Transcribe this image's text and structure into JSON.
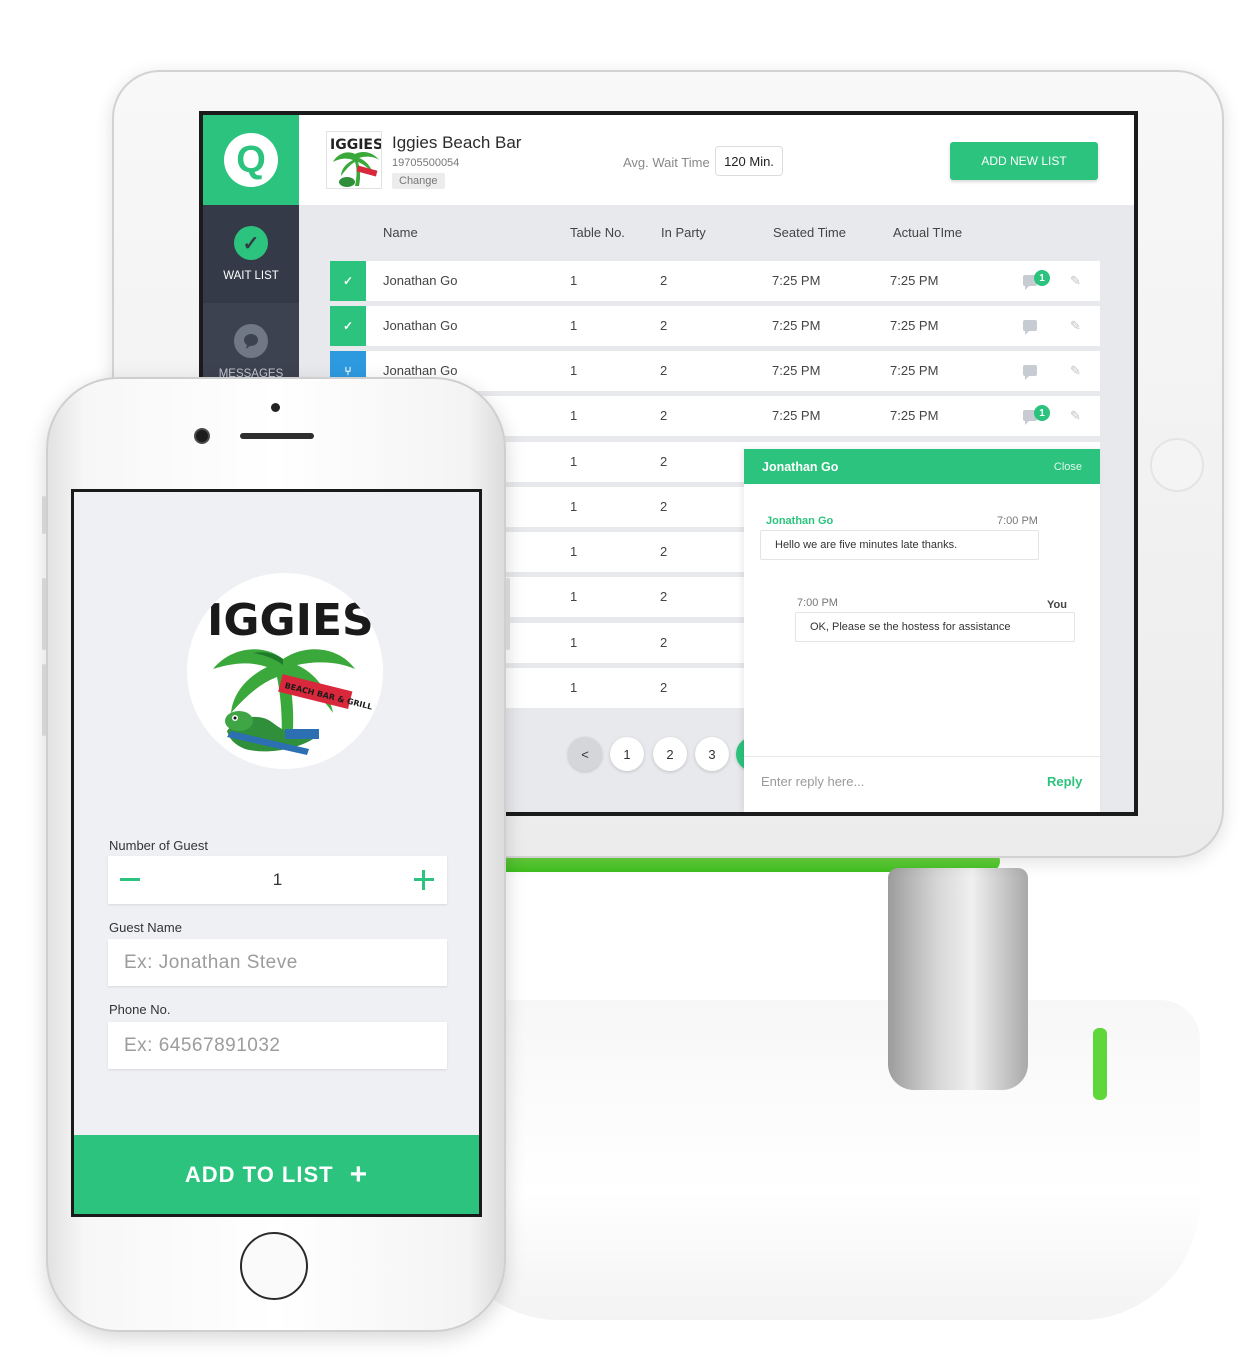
{
  "colors": {
    "accent": "#2bc37d",
    "sidebar": "#3c4250",
    "seated_blue": "#2d9ae0",
    "stand_green": "#5fd63a"
  },
  "tablet": {
    "sidebar": {
      "logo_letter": "Q",
      "items": [
        {
          "label": "WAIT LIST",
          "icon": "check-icon",
          "active": true
        },
        {
          "label": "MESSAGES",
          "icon": "chat-bubble-icon",
          "active": false
        }
      ]
    },
    "header": {
      "restaurant_name": "Iggies Beach Bar",
      "restaurant_phone": "19705500054",
      "change_label": "Change",
      "avg_wait_label": "Avg. Wait Time",
      "avg_wait_value": "120 Min.",
      "add_new_list_label": "ADD NEW LIST"
    },
    "table": {
      "columns": [
        "Name",
        "Table No.",
        "In Party",
        "Seated Time",
        "Actual TIme"
      ],
      "rows": [
        {
          "status": "check",
          "name": "Jonathan Go",
          "table_no": "1",
          "party": "2",
          "seated": "7:25 PM",
          "actual": "7:25 PM",
          "badge": "1"
        },
        {
          "status": "check",
          "name": "Jonathan Go",
          "table_no": "1",
          "party": "2",
          "seated": "7:25 PM",
          "actual": "7:25 PM",
          "badge": ""
        },
        {
          "status": "seated",
          "name": "Jonathan Go",
          "table_no": "1",
          "party": "2",
          "seated": "7:25 PM",
          "actual": "7:25 PM",
          "badge": ""
        },
        {
          "status": "",
          "name": "",
          "table_no": "1",
          "party": "2",
          "seated": "7:25 PM",
          "actual": "7:25 PM",
          "badge": "1"
        },
        {
          "status": "",
          "name": "",
          "table_no": "1",
          "party": "2",
          "seated": "",
          "actual": "",
          "badge": ""
        },
        {
          "status": "",
          "name": "",
          "table_no": "1",
          "party": "2",
          "seated": "",
          "actual": "",
          "badge": ""
        },
        {
          "status": "",
          "name": "",
          "table_no": "1",
          "party": "2",
          "seated": "",
          "actual": "",
          "badge": ""
        },
        {
          "status": "",
          "name": "",
          "table_no": "1",
          "party": "2",
          "seated": "",
          "actual": "",
          "badge": ""
        },
        {
          "status": "",
          "name": "",
          "table_no": "1",
          "party": "2",
          "seated": "",
          "actual": "",
          "badge": ""
        },
        {
          "status": "",
          "name": "",
          "table_no": "1",
          "party": "2",
          "seated": "",
          "actual": "",
          "badge": ""
        }
      ]
    },
    "pagination": {
      "prev": "<",
      "pages": [
        "1",
        "2",
        "3"
      ]
    },
    "chat": {
      "title": "Jonathan Go",
      "close_label": "Close",
      "messages": [
        {
          "sender": "Jonathan Go",
          "time": "7:00 PM",
          "text": "Hello we are five minutes late thanks."
        },
        {
          "sender": "You",
          "time": "7:00 PM",
          "text": "OK, Please se the hostess for assistance"
        }
      ],
      "reply_placeholder": "Enter reply here...",
      "reply_label": "Reply"
    }
  },
  "phone": {
    "logo_text": "IGGIES",
    "logo_subtext": "BEACH BAR & GRILL",
    "guest_count_label": "Number of Guest",
    "guest_count": "1",
    "guest_name_label": "Guest Name",
    "guest_name_placeholder": "Ex: Jonathan Steve",
    "phone_label": "Phone No.",
    "phone_placeholder": "Ex: 64567891032",
    "add_to_list_label": "ADD TO LIST"
  }
}
